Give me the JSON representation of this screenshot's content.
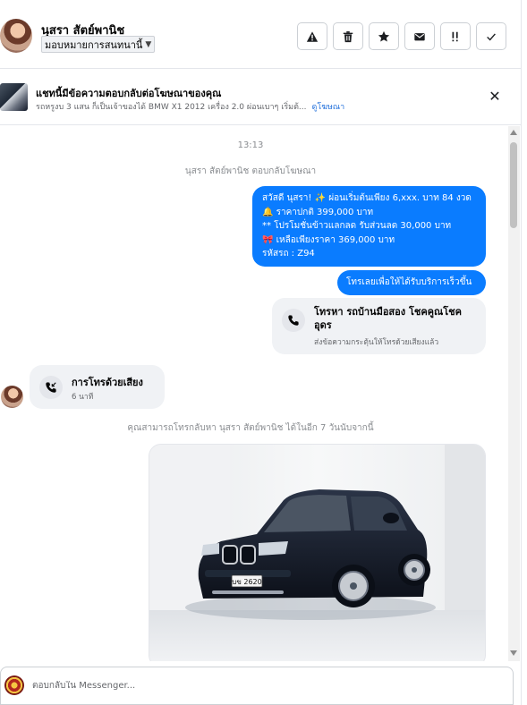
{
  "header": {
    "name": "นุสรา สัตย์พานิช",
    "assign_label": "มอบหมายการสนทนานี้",
    "actions": [
      {
        "name": "spam-button",
        "icon": "warning-icon"
      },
      {
        "name": "delete-button",
        "icon": "trash-icon"
      },
      {
        "name": "star-button",
        "icon": "star-icon"
      },
      {
        "name": "mark-unread-button",
        "icon": "envelope-icon"
      },
      {
        "name": "follow-up-button",
        "icon": "follow-up-icon"
      },
      {
        "name": "done-button",
        "icon": "check-icon"
      }
    ]
  },
  "ad_banner": {
    "title": "แชทนี้มีข้อความตอบกลับต่อโฆษณาของคุณ",
    "subtitle": "รถหรูงบ 3 แสน ก็เป็นเจ้าของได้ BMW X1 2012 เครื่อง 2.0 ผ่อนเบาๆ เริ่มต้...",
    "link": "ดูโฆษณา"
  },
  "chat": {
    "timestamp": "13:13",
    "reply_notice": "นุสรา สัตย์พานิช ตอบกลับโฆษณา",
    "outgoing_lines": [
      "สวัสดี นุสรา! ✨  ผ่อนเริ่มต้นเพียง 6,xxx. บาท 84 งวด",
      "🔔 ราคาปกติ 399,000 บาท",
      "** โปรโมชั่นข้าวแลกลด รับส่วนลด 30,000 บาท",
      "🎀  เหลือเพียงราคา 369,000 บาท",
      "รหัสรถ : Z94"
    ],
    "cta_message": "โทรเลยเพื่อให้ได้รับบริการเร็วขึ้น",
    "call_card": {
      "title": "โทรหา รถบ้านมือสอง โชคคูณโชคอุดร",
      "subtitle": "ส่งข้อความกระตุ้นให้โทรด้วยเสียงแล้ว"
    },
    "voice_call": {
      "title": "การโทรด้วยเสียง",
      "duration": "6 นาที"
    },
    "callback_notice": "คุณสามารถโทรกลับหา นุสรา สัตย์พานิช ได้ในอีก 7 วันนับจากนี้",
    "photo": {
      "plate": "บข 2620"
    }
  },
  "reply": {
    "placeholder": "ตอบกลับใน Messenger..."
  },
  "colors": {
    "accent": "#0a7cff",
    "incoming_bubble": "#f0f2f5"
  }
}
